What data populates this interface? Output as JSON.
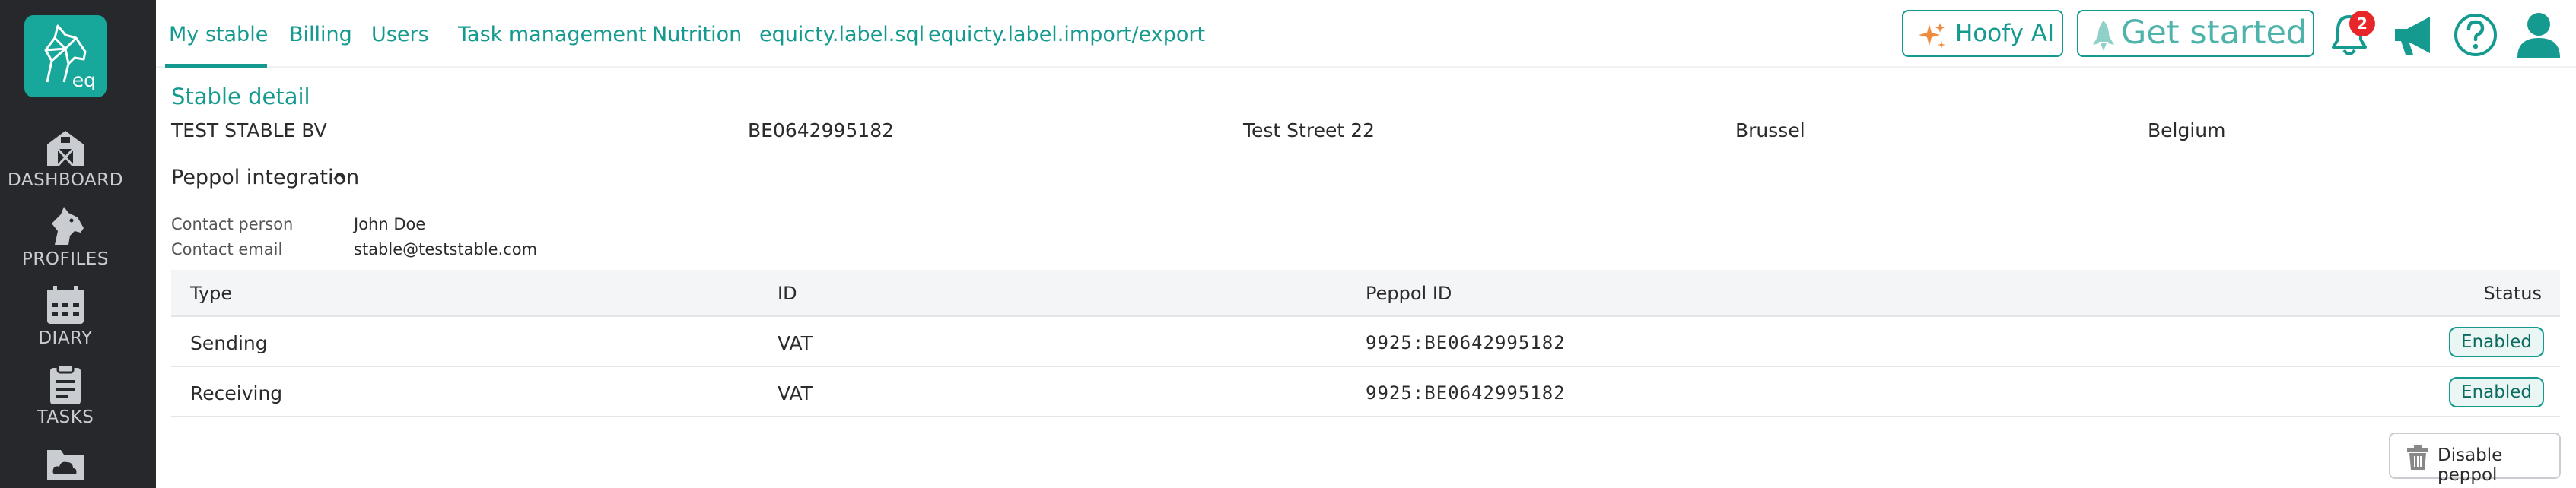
{
  "app": {
    "logo_text": "eq",
    "colors": {
      "accent": "#149a8e",
      "sidebar_bg": "#26282c",
      "badge": "#e8262a"
    }
  },
  "sidebar": {
    "items": [
      {
        "label": "DASHBOARD",
        "icon": "barn-icon"
      },
      {
        "label": "PROFILES",
        "icon": "horse-head-icon"
      },
      {
        "label": "DIARY",
        "icon": "calendar-icon"
      },
      {
        "label": "TASKS",
        "icon": "clipboard-icon"
      },
      {
        "label": "",
        "icon": "folder-cloud-icon"
      }
    ]
  },
  "header": {
    "tabs": [
      {
        "label": "My stable",
        "active": true
      },
      {
        "label": "Billing"
      },
      {
        "label": "Users"
      },
      {
        "label": "Task management"
      },
      {
        "label": "Nutrition"
      },
      {
        "label": "equicty.label.sql"
      },
      {
        "label": "equicty.label.import/export"
      }
    ],
    "hoofy_label": "Hoofy AI",
    "get_started_label": "Get started",
    "notification_count": "2"
  },
  "stable": {
    "section_title": "Stable detail",
    "name": "TEST STABLE BV",
    "vat": "BE0642995182",
    "street": "Test Street 22",
    "city": "Brussel",
    "country": "Belgium"
  },
  "peppol": {
    "title": "Peppol integration",
    "contact_person_label": "Contact person",
    "contact_person": "John Doe",
    "contact_email_label": "Contact email",
    "contact_email": "stable@teststable.com",
    "columns": [
      "Type",
      "ID",
      "Peppol ID",
      "Status"
    ],
    "rows": [
      {
        "type": "Sending",
        "id": "VAT",
        "peppol_id": "9925:BE0642995182",
        "status": "Enabled"
      },
      {
        "type": "Receiving",
        "id": "VAT",
        "peppol_id": "9925:BE0642995182",
        "status": "Enabled"
      }
    ],
    "disable_label": "Disable peppol"
  }
}
